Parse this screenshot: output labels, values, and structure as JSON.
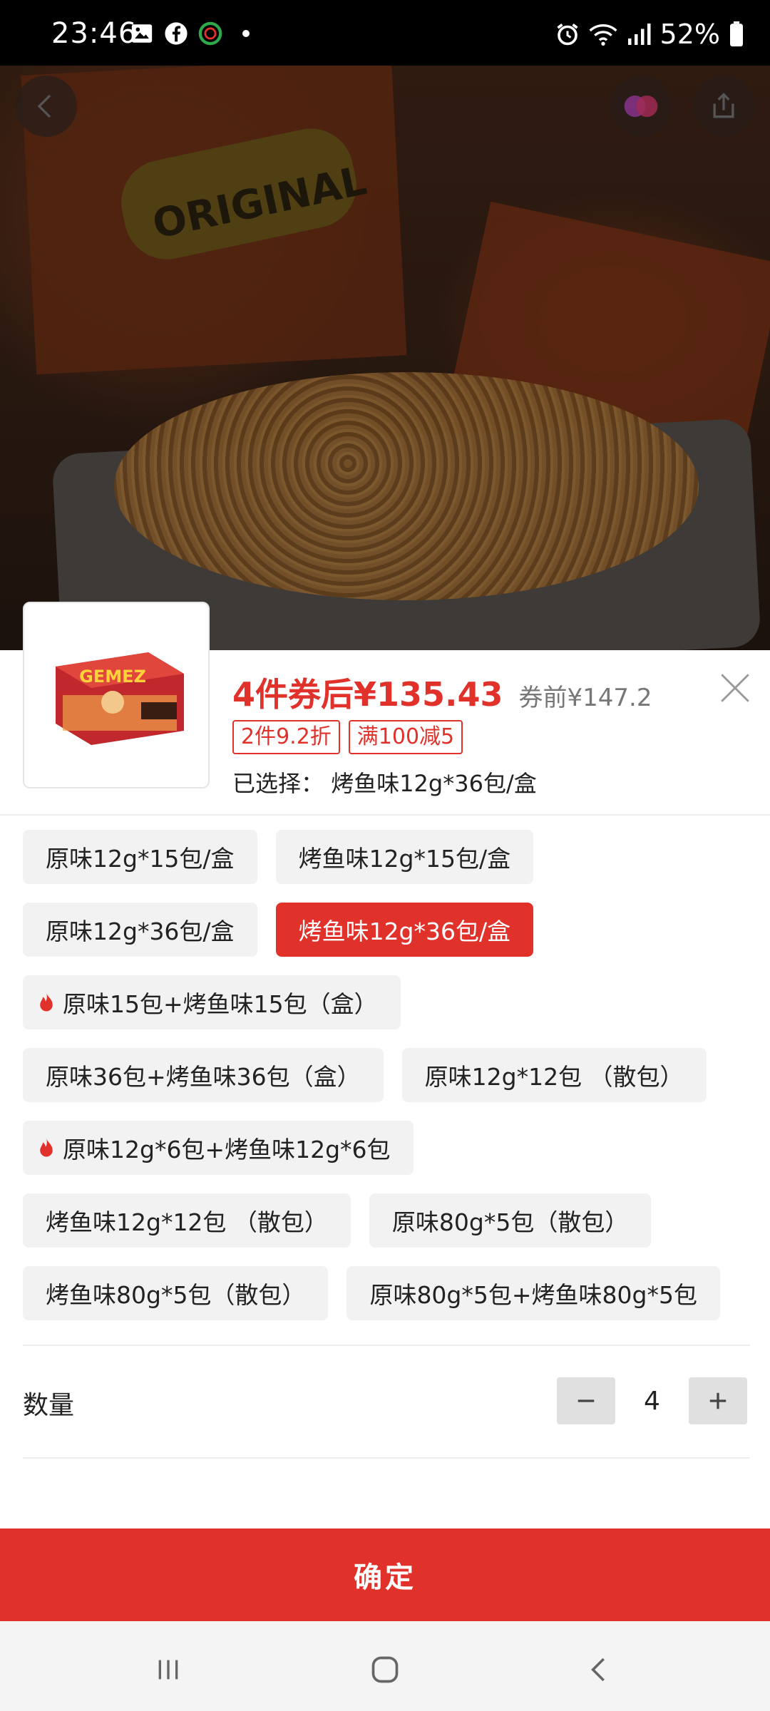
{
  "status_bar": {
    "time": "23:46",
    "battery": "52%"
  },
  "product": {
    "price_after_coupon": "4件券后¥135.43",
    "price_before_coupon": "券前¥147.2",
    "coupons": [
      "2件9.2折",
      "满100减5"
    ],
    "selected_label": "已选择：",
    "selected_value": "烤鱼味12g*36包/盒"
  },
  "options": [
    {
      "label": "原味12g*15包/盒",
      "selected": false,
      "hot": false
    },
    {
      "label": "烤鱼味12g*15包/盒",
      "selected": false,
      "hot": false
    },
    {
      "label": "原味12g*36包/盒",
      "selected": false,
      "hot": false
    },
    {
      "label": "烤鱼味12g*36包/盒",
      "selected": true,
      "hot": false
    },
    {
      "label": "原味15包+烤鱼味15包（盒）",
      "selected": false,
      "hot": true
    },
    {
      "label": "原味36包+烤鱼味36包（盒）",
      "selected": false,
      "hot": false
    },
    {
      "label": "原味12g*12包 （散包）",
      "selected": false,
      "hot": false
    },
    {
      "label": "原味12g*6包+烤鱼味12g*6包",
      "selected": false,
      "hot": true
    },
    {
      "label": "烤鱼味12g*12包 （散包）",
      "selected": false,
      "hot": false
    },
    {
      "label": "原味80g*5包（散包）",
      "selected": false,
      "hot": false
    },
    {
      "label": "烤鱼味80g*5包（散包）",
      "selected": false,
      "hot": false
    },
    {
      "label": "原味80g*5包+烤鱼味80g*5包",
      "selected": false,
      "hot": false
    }
  ],
  "quantity": {
    "label": "数量",
    "value": "4"
  },
  "confirm_label": "确定",
  "hero": {
    "package_text": "ORIGINAL"
  },
  "thumbnail": {
    "brand_text": "GEMEZ"
  },
  "colors": {
    "accent": "#e0322b",
    "chip_bg": "#f2f2f2"
  }
}
